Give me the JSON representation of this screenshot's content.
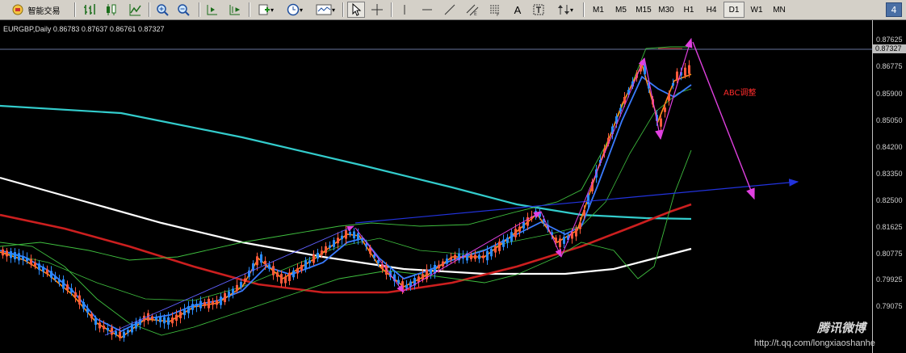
{
  "toolbar": {
    "smart_trading_label": "智能交易",
    "text_tool_label": "A",
    "timeframes": [
      "M1",
      "M5",
      "M15",
      "M30",
      "H1",
      "H4",
      "D1",
      "W1",
      "MN"
    ],
    "active_timeframe": "D1",
    "badge_number": "4"
  },
  "chart": {
    "symbol_info": "EURGBP,Daily  0.86783 0.87637 0.86761 0.87327",
    "current_price": "0.87327",
    "price_labels": [
      "0.87625",
      "0.86775",
      "0.85900",
      "0.85050",
      "0.84200",
      "0.83350",
      "0.82500",
      "0.81625",
      "0.80775",
      "0.79925",
      "0.79075"
    ],
    "annotation_text": "ABC调整",
    "watermark_brand": "腾讯微博",
    "watermark_url": "http://t.qq.com/longxiaoshanhe"
  },
  "colors": {
    "background": "#000000",
    "ma_cyan": "#33cccc",
    "ma_white": "#ffffff",
    "ma_red": "#cc1f1f",
    "bollinger": "#3fbf3f",
    "ma_orange": "#ff8c1a",
    "ma_blue": "#3a7bff",
    "trendline": "#2233dd",
    "abc_arrows": "#e040e0",
    "annotation": "#ff2b2b"
  }
}
